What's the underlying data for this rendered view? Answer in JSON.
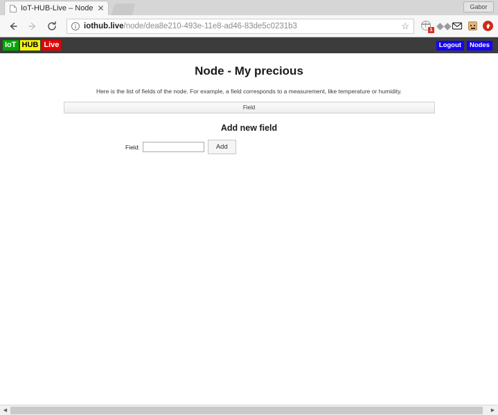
{
  "browser": {
    "tab": {
      "title": "IoT-HUB-Live – Node",
      "favicon_icon": "page-icon",
      "close_icon": "close-icon"
    },
    "new_tab_label": "",
    "profile_name": "Gabor",
    "nav": {
      "back_icon": "back-arrow-icon",
      "forward_icon": "forward-arrow-icon",
      "reload_icon": "reload-icon"
    },
    "url": {
      "security_icon": "info-circle-icon",
      "host": "iothub.live",
      "path": "/node/dea8e210-493e-11e8-ad46-83de5c0231b3",
      "full": "iothub.live/node/dea8e210-493e-11e8-ad46-83de5c0231b3",
      "bookmark_icon": "star-icon"
    },
    "extensions": [
      {
        "name": "globe-icon",
        "badge": "1"
      },
      {
        "name": "dropbox-icon",
        "badge": ""
      },
      {
        "name": "mail-icon",
        "badge": ""
      },
      {
        "name": "robot-icon",
        "badge": ""
      },
      {
        "name": "upload-arrow-icon",
        "badge": ""
      }
    ]
  },
  "site": {
    "logo": {
      "part1": "IoT",
      "part2": "HUB",
      "part3": "Live"
    },
    "nav_links": [
      {
        "label": "Logout"
      },
      {
        "label": "Nodes"
      }
    ],
    "colors": {
      "navbar_bg": "#3c3c3c",
      "logo_green": "#00a800",
      "logo_yellow": "#f5f500",
      "logo_red": "#e60000",
      "link_blue": "#1500ff"
    }
  },
  "page": {
    "title": "Node - My precious",
    "description": "Here is the list of fields of the node. For example, a field corresponds to a measurement, like temperature or humidity.",
    "fields_table": {
      "columns": [
        "Field"
      ],
      "rows": []
    },
    "add_section": {
      "heading": "Add new field",
      "field_label": "Field:",
      "field_value": "",
      "field_placeholder": "",
      "submit_label": "Add"
    }
  },
  "scrollbar": {
    "left_arrow": "◀",
    "right_arrow": "▶"
  }
}
